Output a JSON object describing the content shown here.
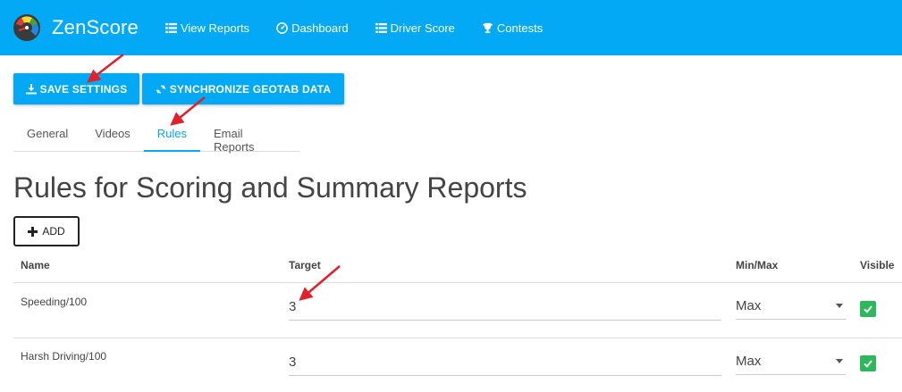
{
  "app": {
    "name": "ZenScore"
  },
  "nav": [
    {
      "label": "View Reports",
      "icon": "list-icon"
    },
    {
      "label": "Dashboard",
      "icon": "dashboard-icon"
    },
    {
      "label": "Driver Score",
      "icon": "list-icon"
    },
    {
      "label": "Contests",
      "icon": "trophy-icon"
    }
  ],
  "toolbar": {
    "save_label": "SAVE SETTINGS",
    "sync_label": "SYNCHRONIZE GEOTAB DATA"
  },
  "tabs": [
    {
      "label": "General",
      "active": false
    },
    {
      "label": "Videos",
      "active": false
    },
    {
      "label": "Rules",
      "active": true
    },
    {
      "label": "Email Reports",
      "active": false
    }
  ],
  "page": {
    "title": "Rules for Scoring and Summary Reports",
    "add_label": "ADD"
  },
  "table": {
    "headers": {
      "name": "Name",
      "target": "Target",
      "minmax": "Min/Max",
      "visible": "Visible"
    },
    "rows": [
      {
        "name": "Speeding/100",
        "target": "3",
        "minmax": "Max",
        "visible": true
      },
      {
        "name": "Harsh Driving/100",
        "target": "3",
        "minmax": "Max",
        "visible": true
      }
    ]
  },
  "colors": {
    "accent": "#03a9f4",
    "check": "#2eb85c",
    "annotation": "#e0202a"
  }
}
